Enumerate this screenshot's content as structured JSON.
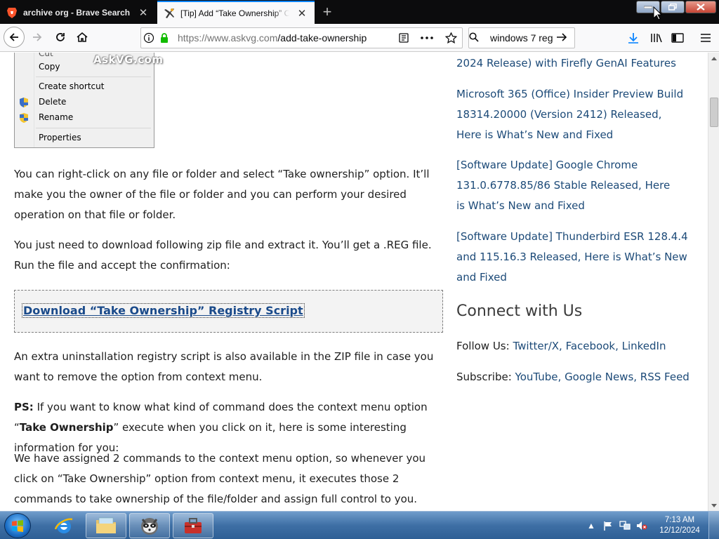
{
  "tabs": [
    {
      "title": "archive org - Brave Search",
      "favicon": "brave-lion-icon",
      "close": "✕"
    },
    {
      "title": "[Tip] Add “Take Ownership” Op",
      "favicon": "askvg-icon",
      "close": "✕",
      "active": true
    }
  ],
  "new_tab": "+",
  "nav": {
    "url_host": "https://www.askvg.com",
    "url_path": "/add-take-ownership",
    "search_value": "windows 7 reg"
  },
  "context_menu": {
    "partial_item": "Cut",
    "items": [
      "Copy",
      "Create shortcut",
      "Delete",
      "Rename",
      "Properties"
    ],
    "watermark": "AskVG.com"
  },
  "article": {
    "p1": "You can right-click on any file or folder and select “Take ownership” option. It’ll make you the owner of the file or folder and you can perform your desired operation on that file or folder.",
    "p2": "You just need to download following zip file and extract it. You’ll get a .REG file. Run the file and accept the confirmation:",
    "download_link": "Download “Take Ownership” Registry Script",
    "p3": "An extra uninstallation registry script is also available in the ZIP file in case you want to remove the option from context menu.",
    "ps_label": "PS:",
    "ps_text_1": " If you want to know what kind of command does the context menu option “",
    "ps_bold": "Take Ownership",
    "ps_text_2": "” execute when you click on it, here is some interesting information for you:",
    "p5": "We have assigned 2 commands to the context menu option, so whenever you click on “Take Ownership” option from context menu, it executes those 2 commands to take ownership of the file/folder and assign full control to you."
  },
  "sidebar": {
    "post0_tail": "2024 Release) with Firefly GenAI Features",
    "post1": "Microsoft 365 (Office) Insider Preview Build 18314.20000 (Version 2412) Released, Here is What’s New and Fixed",
    "post2": "[Software Update] Google Chrome 131.0.6778.85/86 Stable Released, Here is What’s New and Fixed",
    "post3": "[Software Update] Thunderbird ESR 128.4.4 and 115.16.3 Released, Here is What’s New and Fixed",
    "connect_heading": "Connect with Us",
    "follow_label": "Follow Us:",
    "follow_links": "Twitter/X, Facebook, LinkedIn",
    "subscribe_label": "Subscribe:",
    "subscribe_links": "YouTube, Google News, RSS Feed"
  },
  "taskbar": {
    "time": "7:13 AM",
    "date": "12/12/2024",
    "show_hidden": "▲"
  },
  "colors": {
    "tab_strip": "#0c0c0d",
    "toolbar": "#f9f9fa",
    "link": "#1c4a78",
    "taskbar": "#3e6fa5"
  }
}
